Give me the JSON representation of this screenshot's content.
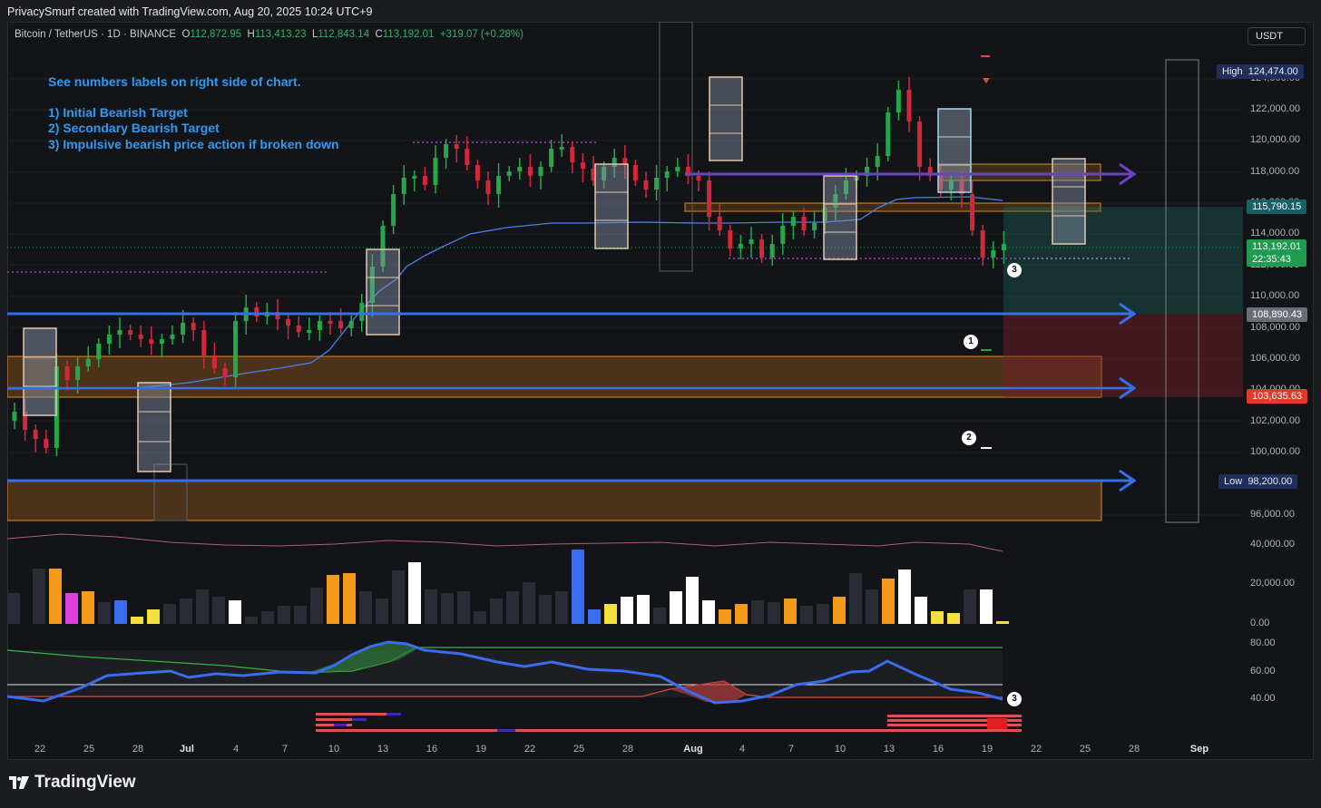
{
  "header": {
    "title": "PrivacySmurf created with TradingView.com, Aug 20, 2025 10:24 UTC+9"
  },
  "symbol": {
    "name": "Bitcoin / TetherUS · 1D · BINANCE",
    "open_key": "O",
    "open": "112,872.95",
    "high_key": "H",
    "high": "113,413.23",
    "low_key": "L",
    "low": "112,843.14",
    "close_key": "C",
    "close": "113,192.01",
    "change": "+319.07 (+0.28%)"
  },
  "currency_button": "USDT",
  "annotations": {
    "line1": "See numbers labels on right side of chart.",
    "line2": "1) Initial Bearish Target",
    "line3": "2) Secondary Bearish Target",
    "line4": "3) Impulsive bearish price action if broken down"
  },
  "price_axis": {
    "labels": [
      "124,000.00",
      "122,000.00",
      "120,000.00",
      "118,000.00",
      "116,000.00",
      "114,000.00",
      "112,000.00",
      "110,000.00",
      "108,000.00",
      "106,000.00",
      "104,000.00",
      "102,000.00",
      "100,000.00",
      "96,000.00"
    ]
  },
  "price_tags": {
    "high_label": "High",
    "high_value": "124,474.00",
    "tag1": "115,790.15",
    "last": "113,192.01",
    "countdown": "22:35:43",
    "tag2": "108,890.43",
    "tag3": "103,635.63",
    "low_label": "Low",
    "low_value": "98,200.00"
  },
  "volume_axis": {
    "labels": [
      "40,000.00",
      "20,000.00",
      "0.00"
    ]
  },
  "osc_axis": {
    "labels": [
      "80.00",
      "60.00",
      "40.00"
    ]
  },
  "time_axis": {
    "labels": [
      "22",
      "25",
      "28",
      "Jul",
      "4",
      "7",
      "10",
      "13",
      "16",
      "19",
      "22",
      "25",
      "28",
      "Aug",
      "4",
      "7",
      "10",
      "13",
      "16",
      "19",
      "22",
      "25",
      "28",
      "Sep"
    ]
  },
  "markers": {
    "m1": "1",
    "m2": "2",
    "m3": "3",
    "m3b": "3"
  },
  "brand": {
    "name": "TradingView"
  },
  "colors": {
    "bull": "#26a84a",
    "bear": "#d2283a",
    "accent": "#2f9bf0"
  }
}
